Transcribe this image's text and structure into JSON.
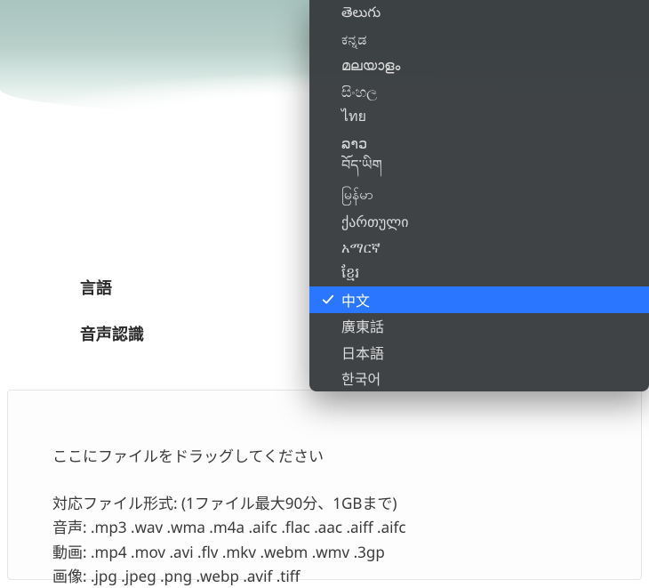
{
  "form": {
    "language_label": "言語",
    "speech_recog_label": "音声認識"
  },
  "dropdown": {
    "items": [
      "తెలుగు",
      "ಕನ್ನಡ",
      "മലയാളം",
      "සිංහල",
      "ไทย",
      "ລາວ",
      "བོད་ཡིག",
      "မြန်မာ",
      "ქართული",
      "አማርኛ",
      "ខ្មែរ",
      "中文",
      "廣東話",
      "日本語",
      "한국어"
    ],
    "selected_index": 11
  },
  "dropzone": {
    "title": "ここにファイルをドラッグしてください",
    "formats_header": "対応ファイル形式: (1ファイル最大90分、1GBまで)",
    "audio": "音声: .mp3 .wav .wma .m4a .aifc .flac .aac .aiff .aifc",
    "video": "動画: .mp4 .mov .avi .flv .mkv .webm .wmv .3gp",
    "image": "画像: .jpg .jpeg .png .webp .avif .tiff"
  }
}
